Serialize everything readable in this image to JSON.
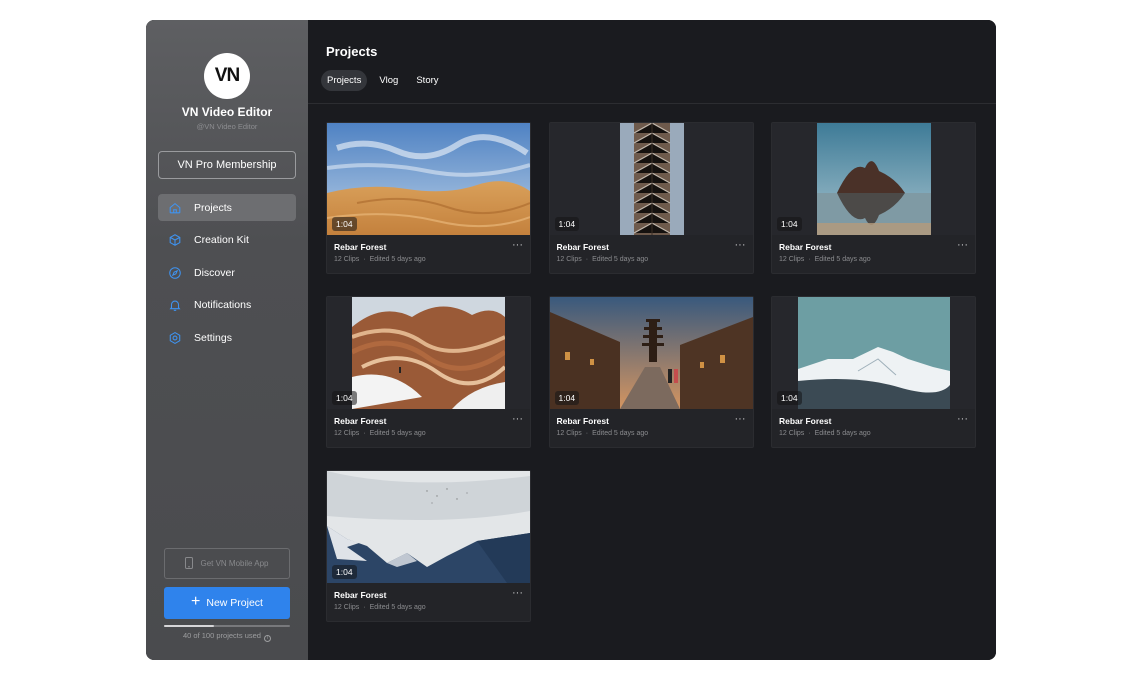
{
  "sidebar": {
    "logo_text": "VN",
    "app_name": "VN Video Editor",
    "app_handle": "@VN Video Editor",
    "pro_button": "VN Pro Membership",
    "nav": [
      {
        "label": "Projects",
        "icon": "home-icon",
        "active": true
      },
      {
        "label": "Creation Kit",
        "icon": "cube-icon",
        "active": false
      },
      {
        "label": "Discover",
        "icon": "compass-icon",
        "active": false
      },
      {
        "label": "Notifications",
        "icon": "bell-icon",
        "active": false
      },
      {
        "label": "Settings",
        "icon": "gear-icon",
        "active": false
      }
    ],
    "mobile_button": "Get VN Mobile App",
    "new_project_button": "New Project",
    "usage_text": "40 of 100 projects used",
    "usage_fraction": 0.4
  },
  "main": {
    "title": "Projects",
    "tabs": [
      {
        "label": "Projects",
        "active": true
      },
      {
        "label": "Vlog",
        "active": false
      },
      {
        "label": "Story",
        "active": false
      }
    ],
    "projects": [
      {
        "title": "Rebar Forest",
        "clips": "12 Clips",
        "edited": "Edited 5 days ago",
        "duration": "1:04",
        "art": "desert"
      },
      {
        "title": "Rebar Forest",
        "clips": "12 Clips",
        "edited": "Edited 5 days ago",
        "duration": "1:04",
        "art": "building"
      },
      {
        "title": "Rebar Forest",
        "clips": "12 Clips",
        "edited": "Edited 5 days ago",
        "duration": "1:04",
        "art": "rock"
      },
      {
        "title": "Rebar Forest",
        "clips": "12 Clips",
        "edited": "Edited 5 days ago",
        "duration": "1:04",
        "art": "canyon"
      },
      {
        "title": "Rebar Forest",
        "clips": "12 Clips",
        "edited": "Edited 5 days ago",
        "duration": "1:04",
        "art": "kyoto"
      },
      {
        "title": "Rebar Forest",
        "clips": "12 Clips",
        "edited": "Edited 5 days ago",
        "duration": "1:04",
        "art": "mountain"
      },
      {
        "title": "Rebar Forest",
        "clips": "12 Clips",
        "edited": "Edited 5 days ago",
        "duration": "1:04",
        "art": "alps"
      }
    ]
  },
  "colors": {
    "accent": "#2f83ec",
    "main_bg": "#1a1b1f",
    "card_bg": "#232428",
    "sidebar_bg": "#4e4f52"
  }
}
